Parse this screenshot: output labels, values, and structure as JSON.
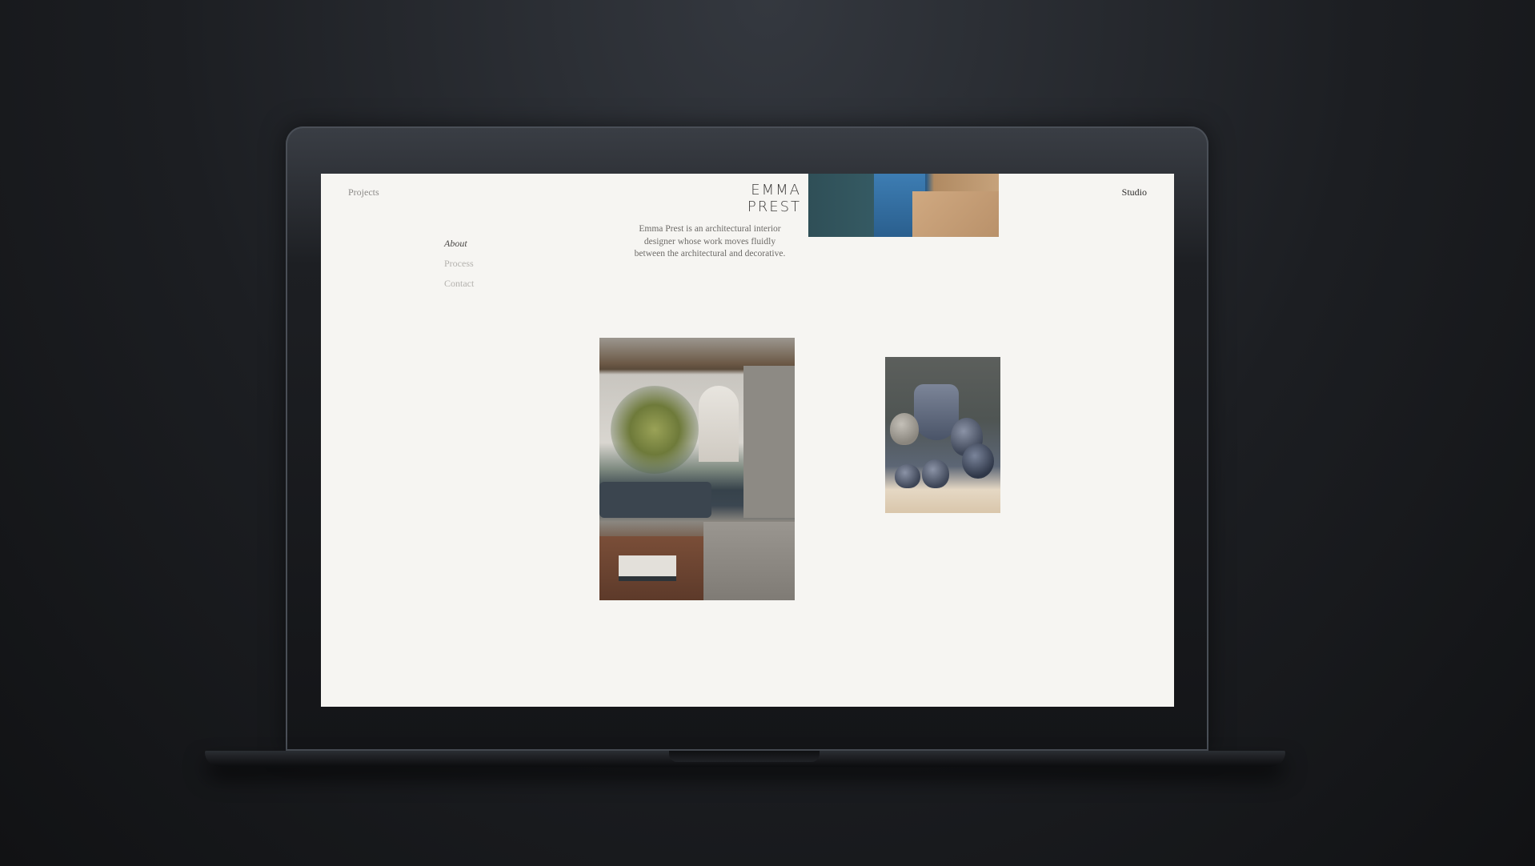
{
  "header": {
    "projects_link": "Projects",
    "brand": "EMMA PREST",
    "studio_link": "Studio"
  },
  "side_nav": {
    "items": [
      "About",
      "Process",
      "Contact"
    ],
    "active": "About"
  },
  "intro": {
    "text": "Emma Prest is an architectural interior designer whose work moves fluidly between the architectural and decorative."
  },
  "colors": {
    "page_background": "#f6f5f2",
    "text_dark": "#2e2d2c",
    "text_muted": "#b4b2ae",
    "device_frame": "#1d1f23"
  }
}
